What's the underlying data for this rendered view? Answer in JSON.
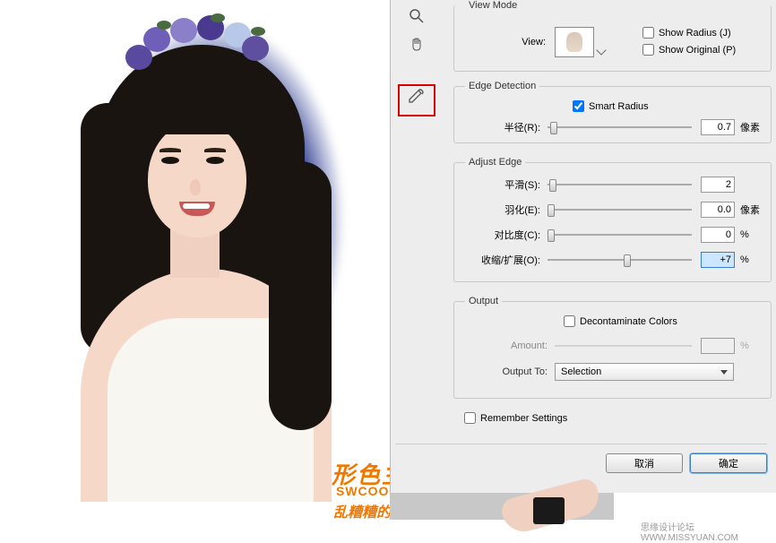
{
  "viewMode": {
    "legend": "View Mode",
    "viewLabel": "View:",
    "showRadius": "Show Radius (J)",
    "showOriginal": "Show Original (P)"
  },
  "edgeDetection": {
    "legend": "Edge Detection",
    "smartRadius": "Smart Radius",
    "radiusLabel": "半径(R):",
    "radiusValue": "0.7",
    "radiusUnit": "像素"
  },
  "adjustEdge": {
    "legend": "Adjust Edge",
    "smoothLabel": "平滑(S):",
    "smoothValue": "2",
    "featherLabel": "羽化(E):",
    "featherValue": "0.0",
    "featherUnit": "像素",
    "contrastLabel": "对比度(C):",
    "contrastValue": "0",
    "contrastUnit": "%",
    "shiftLabel": "收缩/扩展(O):",
    "shiftValue": "+7",
    "shiftUnit": "%"
  },
  "output": {
    "legend": "Output",
    "decontaminate": "Decontaminate Colors",
    "amountLabel": "Amount:",
    "amountUnit": "%",
    "outputToLabel": "Output To:",
    "outputToValue": "Selection"
  },
  "remember": "Remember Settings",
  "buttons": {
    "cancel": "取消",
    "ok": "确定"
  },
  "watermark": {
    "line1": "形色主义",
    "line2": "SWCOOL.COM",
    "line3": "乱糟糟的季节"
  },
  "footer": "思缘设计论坛   WWW.MISSYUAN.COM"
}
